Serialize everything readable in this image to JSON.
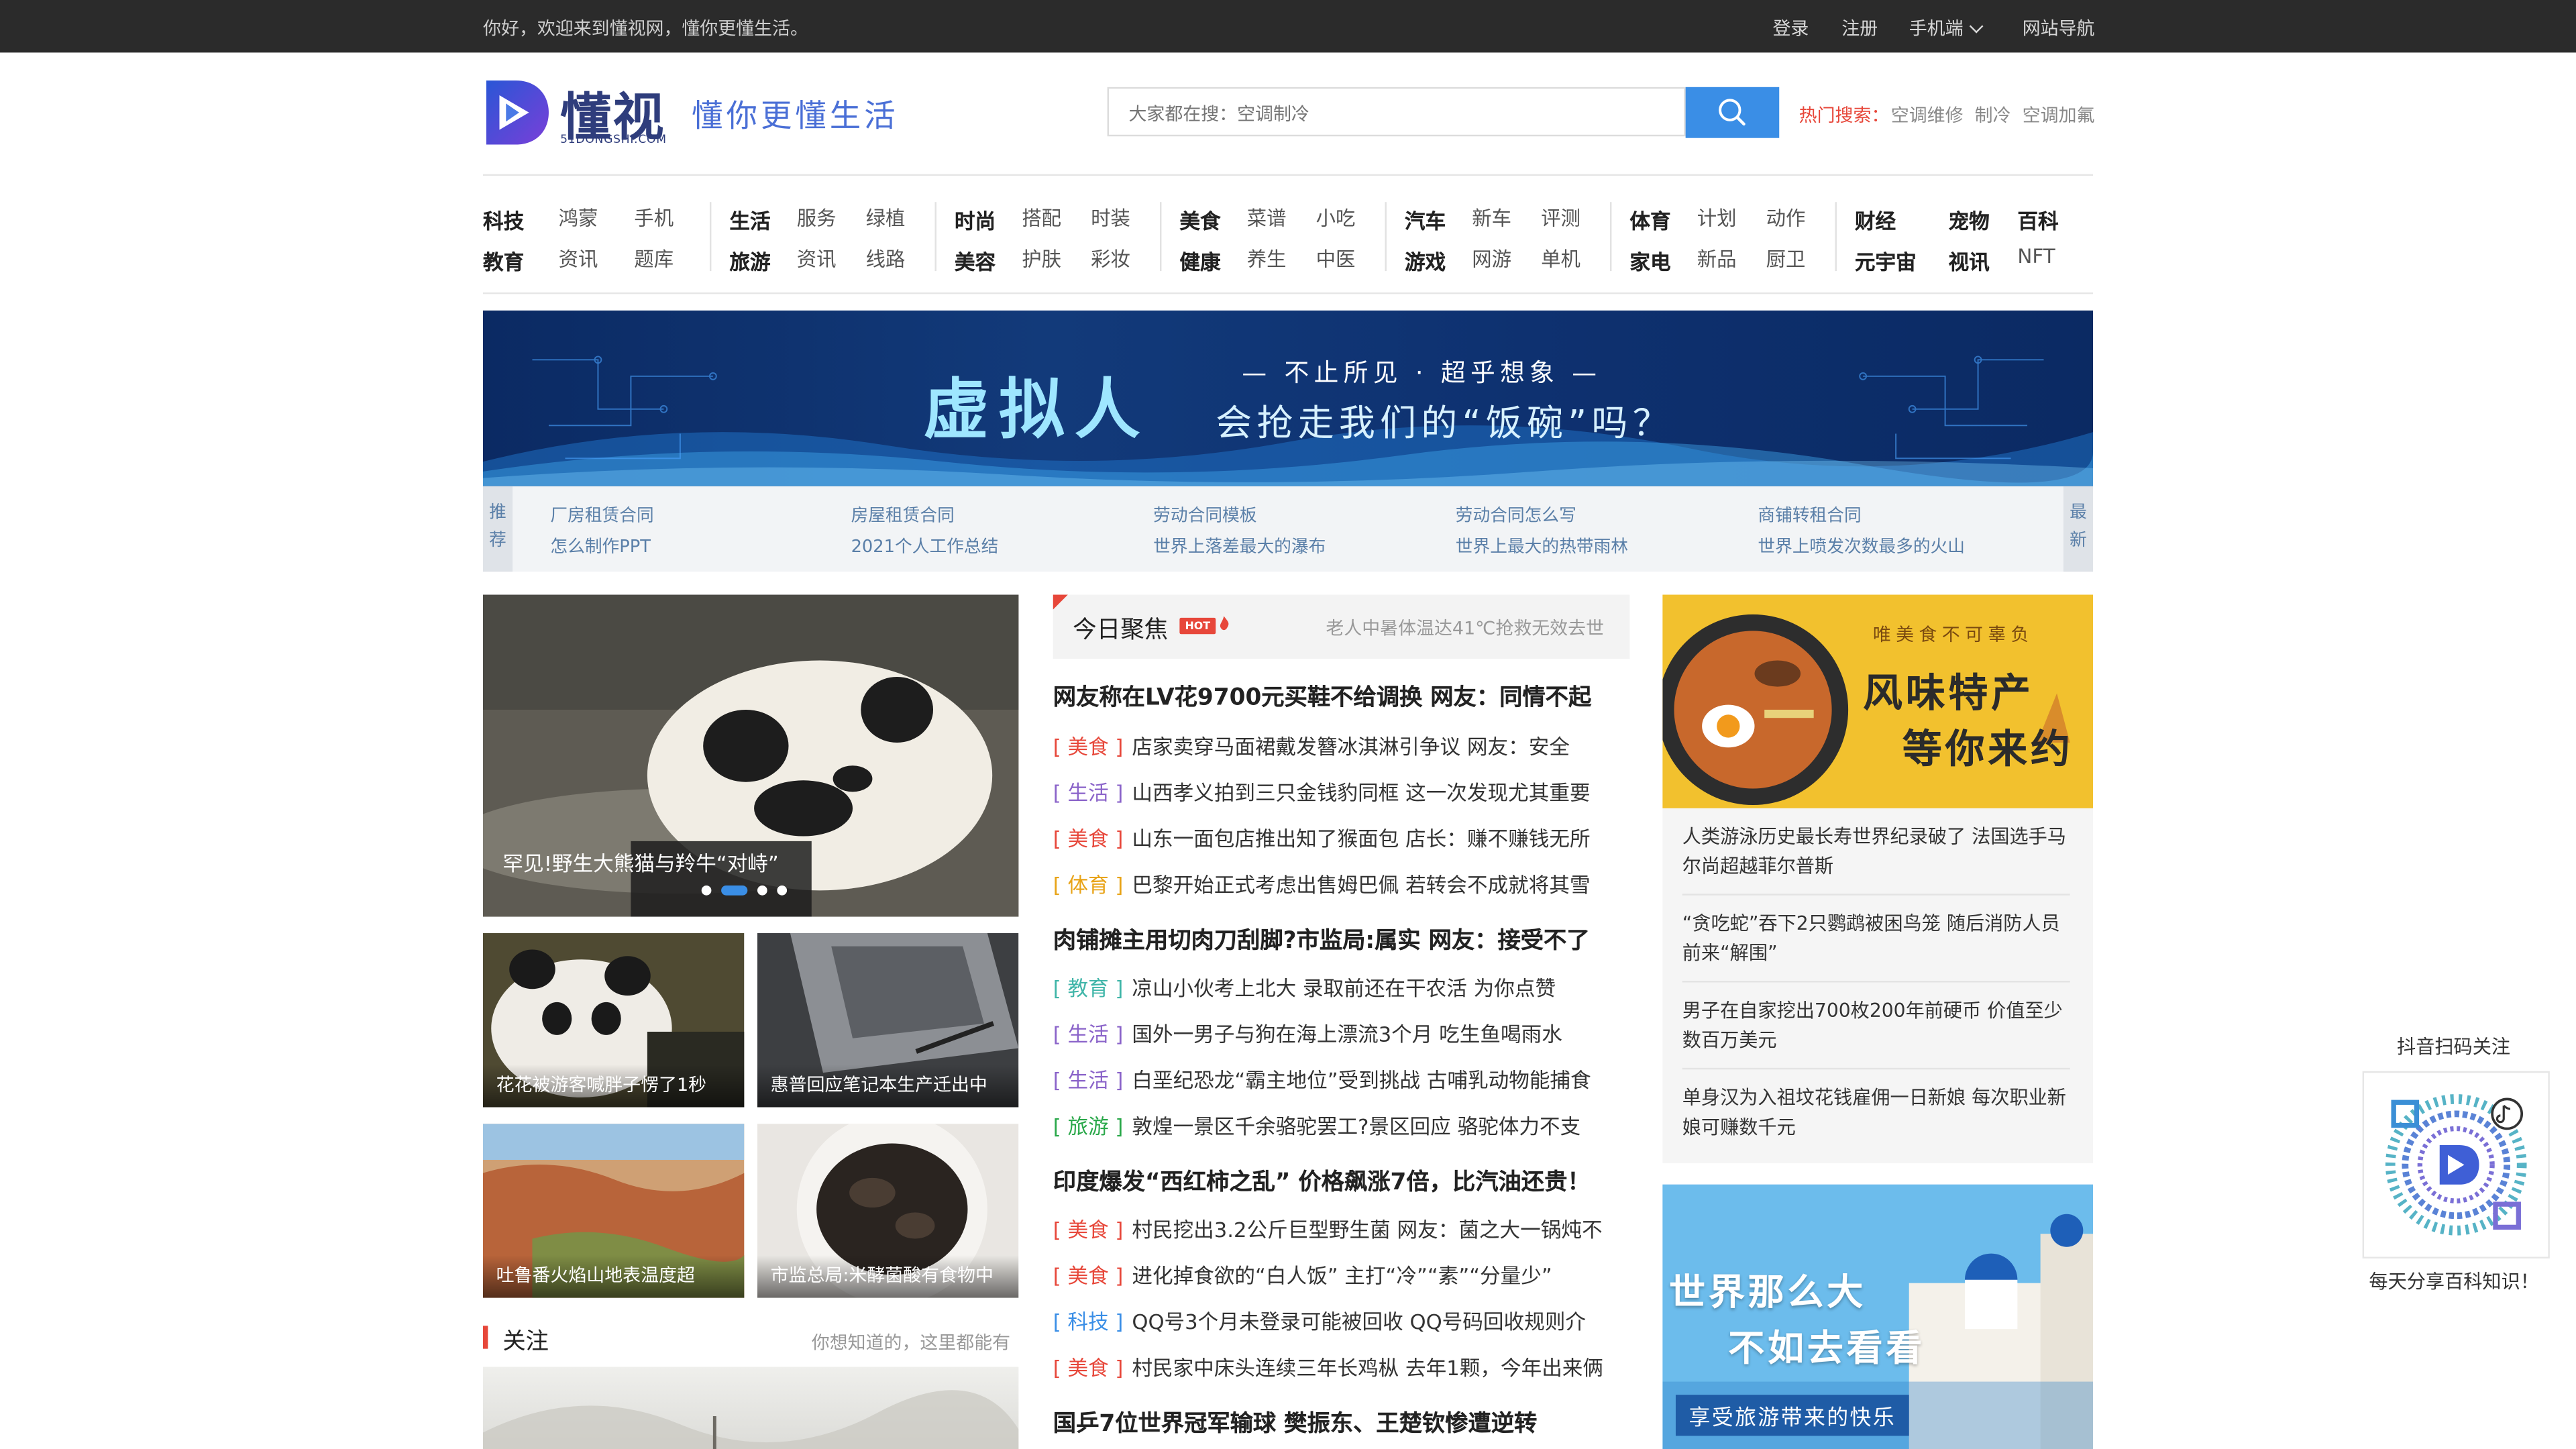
{
  "topbar": {
    "greeting": "你好，欢迎来到懂视网，懂你更懂生活。",
    "login": "登录",
    "register": "注册",
    "mobile": "手机端",
    "sitenav": "网站导航"
  },
  "header": {
    "logo_text": "懂视",
    "logo_sub": "51DONGSHI.COM",
    "slogan": "懂你更懂生活",
    "search_placeholder": "大家都在搜：空调制冷",
    "hot_label": "热门搜索：",
    "hot_items": [
      "空调维修",
      "制冷",
      "空调加氟"
    ]
  },
  "nav": [
    {
      "row1": [
        "科技",
        "鸿蒙",
        "手机"
      ],
      "row2": [
        "教育",
        "资讯",
        "题库"
      ]
    },
    {
      "row1": [
        "生活",
        "服务",
        "绿植"
      ],
      "row2": [
        "旅游",
        "资讯",
        "线路"
      ]
    },
    {
      "row1": [
        "时尚",
        "搭配",
        "时装"
      ],
      "row2": [
        "美容",
        "护肤",
        "彩妆"
      ]
    },
    {
      "row1": [
        "美食",
        "菜谱",
        "小吃"
      ],
      "row2": [
        "健康",
        "养生",
        "中医"
      ]
    },
    {
      "row1": [
        "汽车",
        "新车",
        "评测"
      ],
      "row2": [
        "游戏",
        "网游",
        "单机"
      ]
    },
    {
      "row1": [
        "体育",
        "计划",
        "动作"
      ],
      "row2": [
        "家电",
        "新品",
        "厨卫"
      ]
    },
    {
      "row1": [
        "财经",
        "宠物",
        "百科"
      ],
      "row2": [
        "元宇宙",
        "视讯",
        "NFT"
      ]
    }
  ],
  "banner": {
    "title": "虚拟人",
    "tagline": "— 不止所见 · 超乎想象 —",
    "question": "会抢走我们的“饭碗”吗？"
  },
  "recommend": {
    "left_label": "推荐",
    "right_label": "最新",
    "items": [
      [
        "厂房租赁合同",
        "怎么制作PPT"
      ],
      [
        "房屋租赁合同",
        "2021个人工作总结"
      ],
      [
        "劳动合同模板",
        "世界上落差最大的瀑布"
      ],
      [
        "劳动合同怎么写",
        "世界上最大的热带雨林"
      ],
      [
        "商铺转租合同",
        "世界上喷发次数最多的火山"
      ]
    ]
  },
  "carousel": {
    "caption": "罕见!野生大熊猫与羚牛“对峙”"
  },
  "thumbs": [
    {
      "caption": "花花被游客喊胖子愣了1秒"
    },
    {
      "caption": "惠普回应笔记本生产迁出中"
    },
    {
      "caption": "吐鲁番火焰山地表温度超"
    },
    {
      "caption": "市监总局:米酵菌酸有食物中"
    }
  ],
  "follow": {
    "title": "关注",
    "subtitle": "你想知道的，这里都能有"
  },
  "focus": {
    "title": "今日聚焦",
    "badge": "HOT",
    "right_text": "老人中暑体温达41℃抢救无效去世",
    "groups": [
      {
        "headline": "网友称在LV花9700元买鞋不给调换 网友：同情不起",
        "items": [
          {
            "tag": "[ 美食 ]",
            "text": "店家卖穿马面裙戴发簪冰淇淋引争议 网友：安全"
          },
          {
            "tag": "[ 生活 ]",
            "text": "山西孝义拍到三只金钱豹同框 这一次发现尤其重要"
          },
          {
            "tag": "[ 美食 ]",
            "text": "山东一面包店推出知了猴面包 店长：赚不赚钱无所"
          },
          {
            "tag": "[ 体育 ]",
            "text": "巴黎开始正式考虑出售姆巴佩 若转会不成就将其雪"
          }
        ]
      },
      {
        "headline": "肉铺摊主用切肉刀刮脚?市监局:属实 网友：接受不了",
        "items": [
          {
            "tag": "[ 教育 ]",
            "text": "凉山小伙考上北大 录取前还在干农活 为你点赞"
          },
          {
            "tag": "[ 生活 ]",
            "text": "国外一男子与狗在海上漂流3个月 吃生鱼喝雨水"
          },
          {
            "tag": "[ 生活 ]",
            "text": "白垩纪恐龙“霸主地位”受到挑战 古哺乳动物能捕食"
          },
          {
            "tag": "[ 旅游 ]",
            "text": "敦煌一景区千余骆驼罢工?景区回应 骆驼体力不支"
          }
        ]
      },
      {
        "headline": "印度爆发“西红柿之乱” 价格飙涨7倍，比汽油还贵！",
        "items": [
          {
            "tag": "[ 美食 ]",
            "text": "村民挖出3.2公斤巨型野生菌 网友：菌之大一锅炖不"
          },
          {
            "tag": "[ 美食 ]",
            "text": "进化掉食欲的“白人饭” 主打“冷”“素”“分量少”"
          },
          {
            "tag": "[ 科技 ]",
            "text": "QQ号3个月未登录可能被回收 QQ号码回收规则介"
          },
          {
            "tag": "[ 美食 ]",
            "text": "村民家中床头连续三年长鸡枞 去年1颗，今年出来俩"
          }
        ]
      },
      {
        "headline": "国乒7位世界冠军输球 樊振东、王楚钦惨遭逆转",
        "items": []
      }
    ]
  },
  "right": {
    "ad1": {
      "tag": "唯美食不可辜负",
      "line1": "风味特产",
      "line2": "等你来约"
    },
    "news": [
      "人类游泳历史最长寿世界纪录破了 法国选手马尔尚超越菲尔普斯",
      "“贪吃蛇”吞下2只鹦鹉被困鸟笼 随后消防人员前来“解围”",
      "男子在自家挖出700枚200年前硬币 价值至少数百万美元",
      "单身汉为入祖坟花钱雇佣一日新娘 每次职业新娘可赚数千元"
    ],
    "ad2": {
      "line1": "世界那么大",
      "line2": "不如去看看",
      "line3": "享受旅游带来的快乐"
    }
  },
  "qr": {
    "title": "抖音扫码关注",
    "subtitle": "每天分享百科知识！"
  },
  "colors": {
    "accent_blue": "#3a8ee6",
    "accent_red": "#e7473a",
    "tag_food": "#e7473a",
    "tag_life": "#8a63c9",
    "tag_sport": "#e8a317",
    "tag_edu": "#3fb5a8",
    "tag_travel": "#2aa84a",
    "tag_tech": "#3a8ee6"
  }
}
